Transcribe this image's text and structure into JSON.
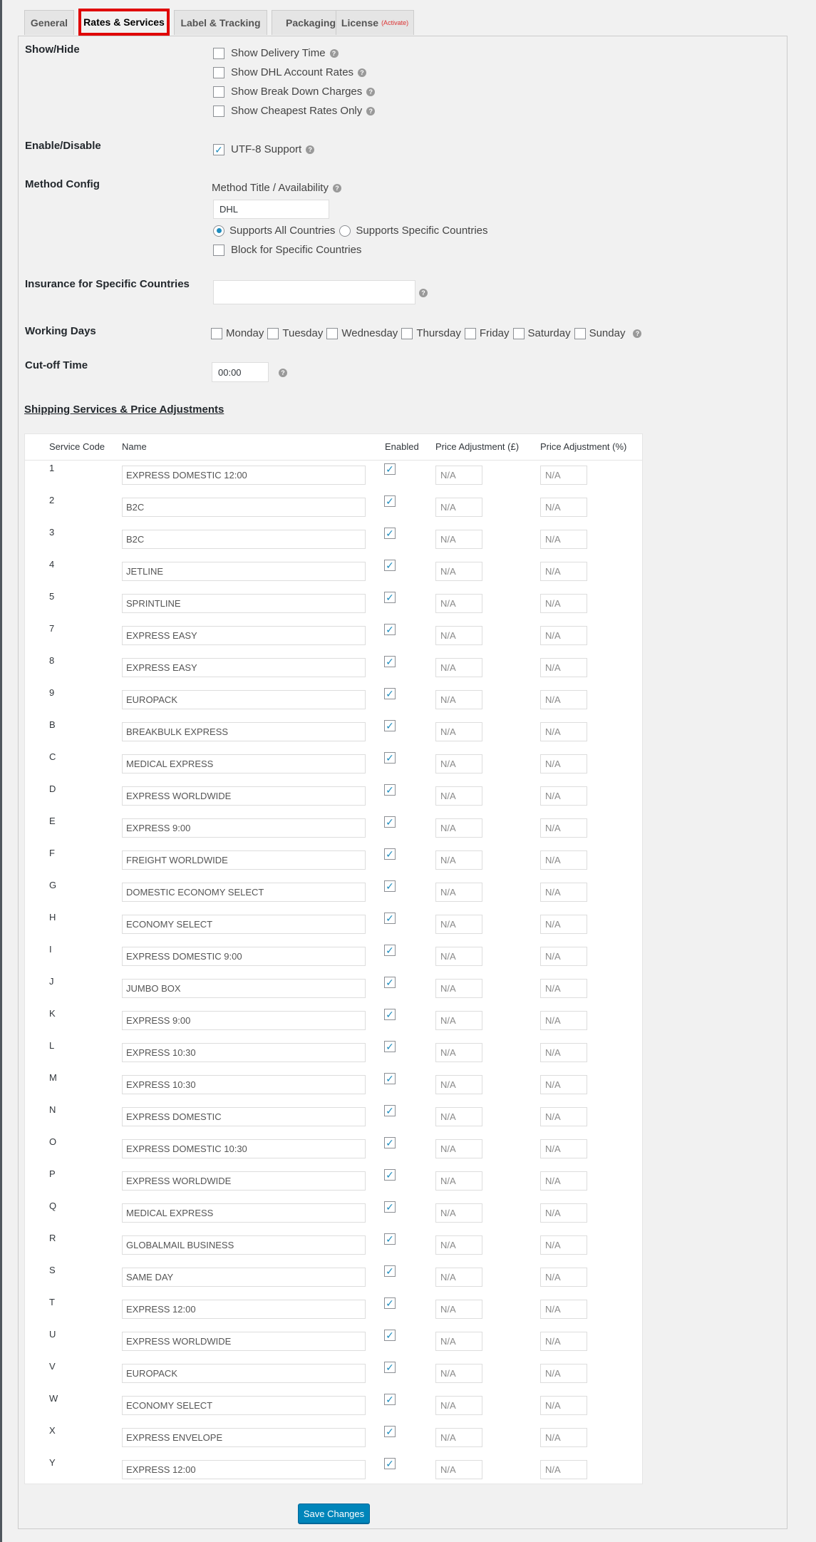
{
  "tabs": [
    {
      "label": "General",
      "active": false
    },
    {
      "label": "Rates & Services",
      "active": true
    },
    {
      "label": "Label & Tracking",
      "active": false
    },
    {
      "label": "Packaging",
      "active": false
    },
    {
      "label": "License",
      "badge": "(Activate)",
      "active": false
    }
  ],
  "show_hide": {
    "label": "Show/Hide",
    "options": [
      {
        "label": "Show Delivery Time",
        "checked": false
      },
      {
        "label": "Show DHL Account Rates",
        "checked": false
      },
      {
        "label": "Show Break Down Charges",
        "checked": false
      },
      {
        "label": "Show Cheapest Rates Only",
        "checked": false
      }
    ]
  },
  "enable_disable": {
    "label": "Enable/Disable",
    "option": "UTF-8 Support",
    "checked": true
  },
  "method_config": {
    "label": "Method Config",
    "title_label": "Method Title / Availability",
    "title_value": "DHL",
    "radio_all": "Supports All Countries",
    "radio_specific": "Supports Specific Countries",
    "block_label": "Block for Specific Countries"
  },
  "insurance": {
    "label": "Insurance for Specific Countries",
    "value": ""
  },
  "working_days": {
    "label": "Working Days",
    "days": [
      "Monday",
      "Tuesday",
      "Wednesday",
      "Thursday",
      "Friday",
      "Saturday",
      "Sunday"
    ]
  },
  "cutoff": {
    "label": "Cut-off Time",
    "value": "00:00"
  },
  "services_section": {
    "title": "Shipping Services & Price Adjustments",
    "headers": {
      "code": "Service Code",
      "name": "Name",
      "enabled": "Enabled",
      "price_gbp": "Price Adjustment (£)",
      "price_pct": "Price Adjustment (%)"
    },
    "placeholder": "N/A",
    "rows": [
      {
        "code": "1",
        "name": "EXPRESS DOMESTIC 12:00"
      },
      {
        "code": "2",
        "name": "B2C"
      },
      {
        "code": "3",
        "name": "B2C"
      },
      {
        "code": "4",
        "name": "JETLINE"
      },
      {
        "code": "5",
        "name": "SPRINTLINE"
      },
      {
        "code": "7",
        "name": "EXPRESS EASY"
      },
      {
        "code": "8",
        "name": "EXPRESS EASY"
      },
      {
        "code": "9",
        "name": "EUROPACK"
      },
      {
        "code": "B",
        "name": "BREAKBULK EXPRESS"
      },
      {
        "code": "C",
        "name": "MEDICAL EXPRESS"
      },
      {
        "code": "D",
        "name": "EXPRESS WORLDWIDE"
      },
      {
        "code": "E",
        "name": "EXPRESS 9:00"
      },
      {
        "code": "F",
        "name": "FREIGHT WORLDWIDE"
      },
      {
        "code": "G",
        "name": "DOMESTIC ECONOMY SELECT"
      },
      {
        "code": "H",
        "name": "ECONOMY SELECT"
      },
      {
        "code": "I",
        "name": "EXPRESS DOMESTIC 9:00"
      },
      {
        "code": "J",
        "name": "JUMBO BOX"
      },
      {
        "code": "K",
        "name": "EXPRESS 9:00"
      },
      {
        "code": "L",
        "name": "EXPRESS 10:30"
      },
      {
        "code": "M",
        "name": "EXPRESS 10:30"
      },
      {
        "code": "N",
        "name": "EXPRESS DOMESTIC"
      },
      {
        "code": "O",
        "name": "EXPRESS DOMESTIC 10:30"
      },
      {
        "code": "P",
        "name": "EXPRESS WORLDWIDE"
      },
      {
        "code": "Q",
        "name": "MEDICAL EXPRESS"
      },
      {
        "code": "R",
        "name": "GLOBALMAIL BUSINESS"
      },
      {
        "code": "S",
        "name": "SAME DAY"
      },
      {
        "code": "T",
        "name": "EXPRESS 12:00"
      },
      {
        "code": "U",
        "name": "EXPRESS WORLDWIDE"
      },
      {
        "code": "V",
        "name": "EUROPACK"
      },
      {
        "code": "W",
        "name": "ECONOMY SELECT"
      },
      {
        "code": "X",
        "name": "EXPRESS ENVELOPE"
      },
      {
        "code": "Y",
        "name": "EXPRESS 12:00"
      }
    ]
  },
  "save_button": "Save Changes",
  "colors": {
    "accent": "#0085ba",
    "tab_highlight": "#e00000",
    "check": "#1e8cbe"
  }
}
